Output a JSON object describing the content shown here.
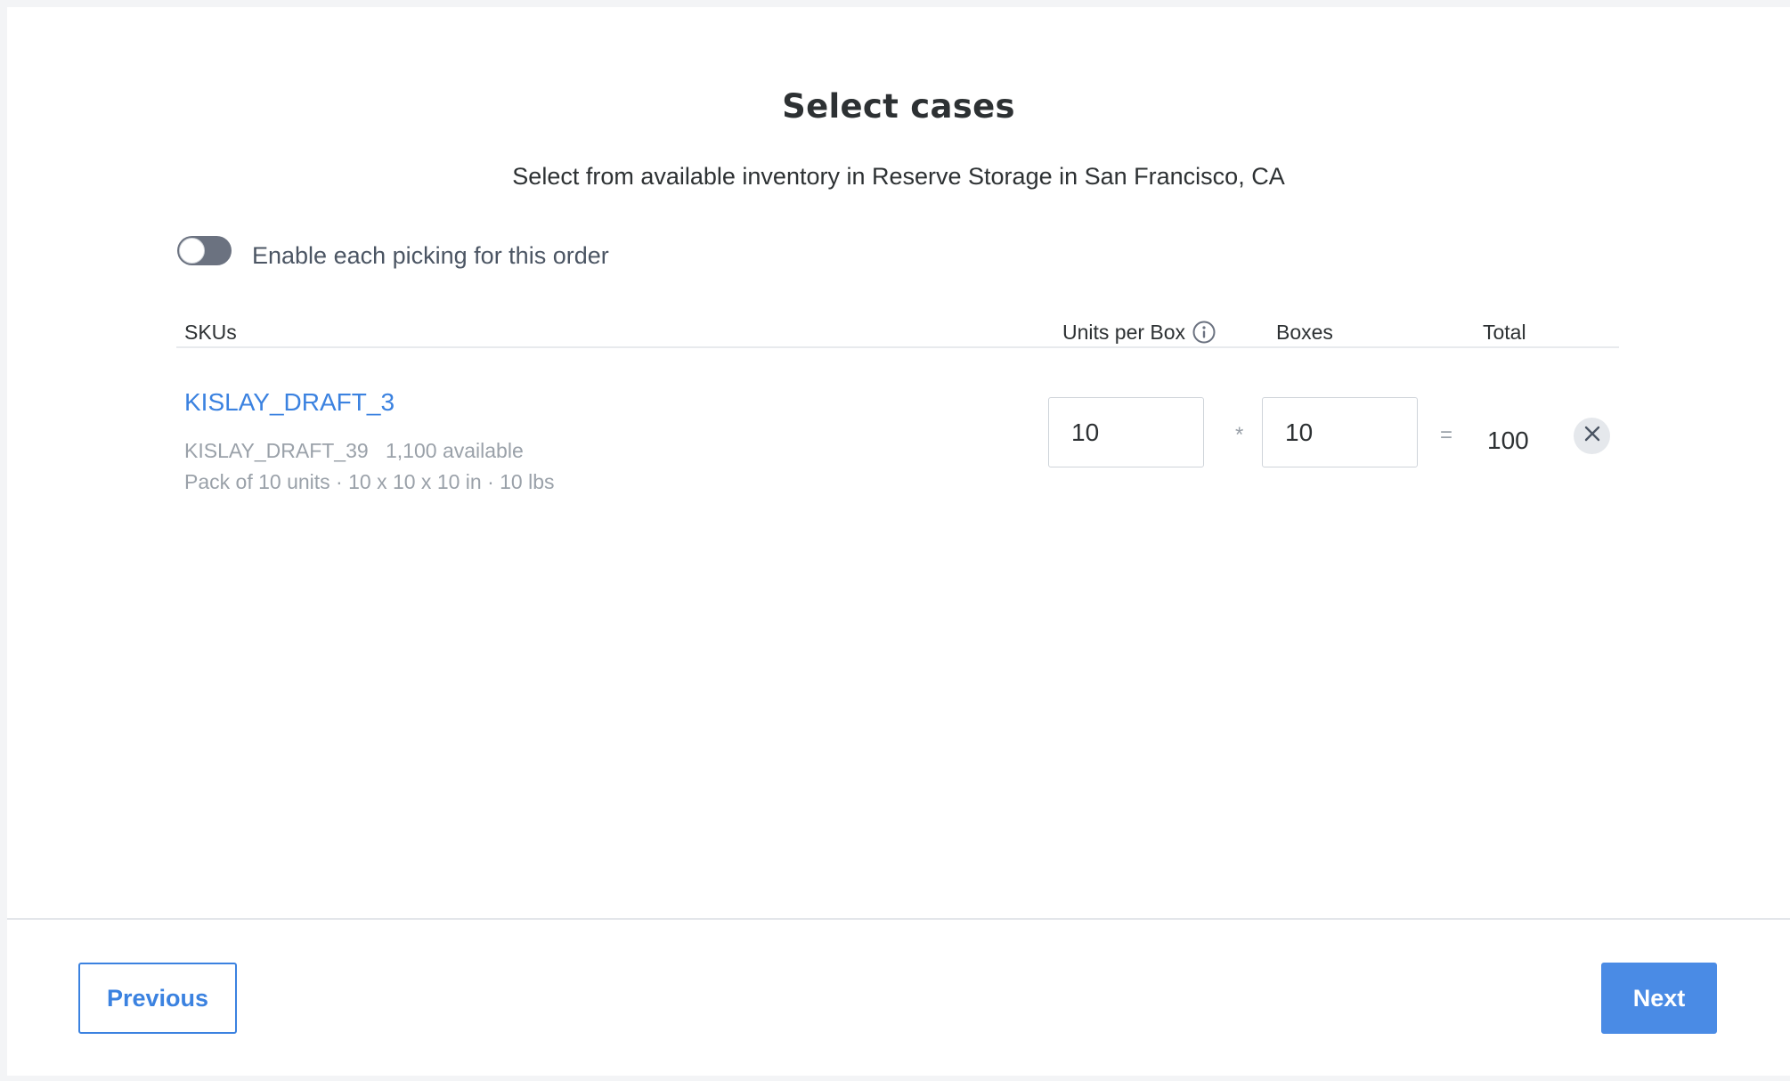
{
  "header": {
    "title": "Select cases",
    "subtitle": "Select from available inventory in Reserve Storage in San Francisco, CA"
  },
  "each_picking": {
    "label": "Enable each picking for this order",
    "enabled": false
  },
  "table": {
    "columns": {
      "skus": "SKUs",
      "units_per_box": "Units per Box",
      "boxes": "Boxes",
      "total": "Total"
    },
    "rows": [
      {
        "name": "KISLAY_DRAFT_3",
        "code": "KISLAY_DRAFT_39",
        "available": "1,100 available",
        "pack": "Pack of 10 units · 10 x 10 x 10 in · 10 lbs",
        "units_per_box": "10",
        "multiply_symbol": "*",
        "boxes": "10",
        "equals_symbol": "=",
        "total": "100"
      }
    ]
  },
  "footer": {
    "previous_label": "Previous",
    "next_label": "Next"
  },
  "icons": {
    "info": "info-circle-icon",
    "remove": "close-icon"
  },
  "colors": {
    "accent": "#3b82e0",
    "primary_button": "#4a8be5",
    "toggle_off": "#6b7280"
  }
}
